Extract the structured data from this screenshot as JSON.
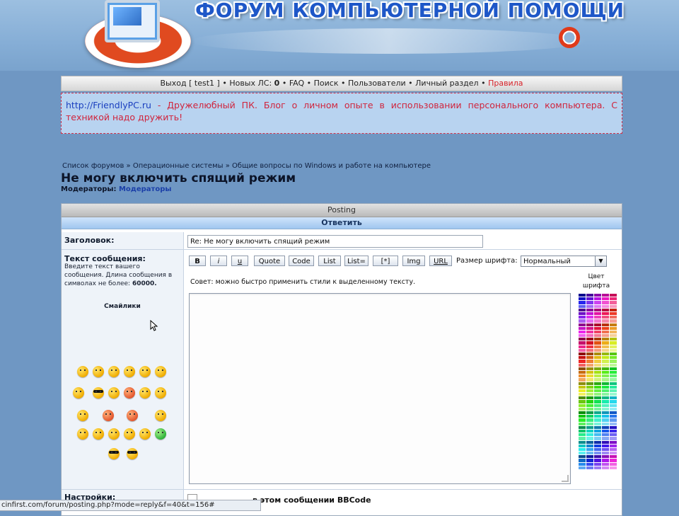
{
  "header": {
    "title": "ФОРУМ КОМПЬЮТЕРНОЙ ПОМОЩИ"
  },
  "nav": {
    "logout_prefix": "Выход [",
    "user": "test1",
    "logout_suffix": "]",
    "new_pm_label": "Новых ЛС:",
    "new_pm_count": "0",
    "faq": "FAQ",
    "search": "Поиск",
    "users": "Пользователи",
    "profile": "Личный раздел",
    "rules": "Правила",
    "sep": "•"
  },
  "ad": {
    "url": "http://FriendlyPC.ru",
    "text": " - Дружелюбный ПК. Блог о личном опыте в использовании персонального компьютера. С техникой надо дружить!"
  },
  "breadcrumb": {
    "forums": "Список форумов",
    "os": "Операционные системы",
    "topic": "Общие вопросы по Windows и работе на компьютере",
    "sep": "»"
  },
  "page": {
    "title": "Не могу включить спящий режим",
    "moderators_label": "Модераторы:",
    "moderators_value": "Модераторы"
  },
  "panel": {
    "header": "Posting",
    "subheader": "Ответить"
  },
  "form": {
    "subject_label": "Заголовок:",
    "subject_value": "Re: Не могу включить спящий режим",
    "message_label": "Текст сообщения:",
    "message_hint": "Введите текст вашего сообщения. Длина сообщения в символах не более:",
    "message_max": "60000.",
    "smilies_title": "Смайлики",
    "tip": "Совет: можно быстро применить стили к выделенному тексту.",
    "font_size_label": "Размер шрифта:",
    "font_size_value": "Нормальный",
    "color_label": "Цвет шрифта",
    "settings_label": "Настройки:",
    "settings_text": "в этом сообщении BBCode"
  },
  "toolbar": {
    "bold": "B",
    "italic": "i",
    "underline": "u",
    "quote": "Quote",
    "code": "Code",
    "list": "List",
    "list_ordered": "List=",
    "list_item": "[*]",
    "img": "Img",
    "url": "URL"
  },
  "statusbar": {
    "url": "cinfirst.com/forum/posting.php?mode=reply&f=40&t=156#"
  },
  "colors": {
    "background": "#6f97c3",
    "ad_text": "#d0243c",
    "link": "#1a3fbf",
    "rules": "#d8232a"
  },
  "icons": {
    "logo": "computer-lifebuoy-logo",
    "smilies": "smiley-face-icons",
    "cursor": "mouse-pointer-icon"
  }
}
